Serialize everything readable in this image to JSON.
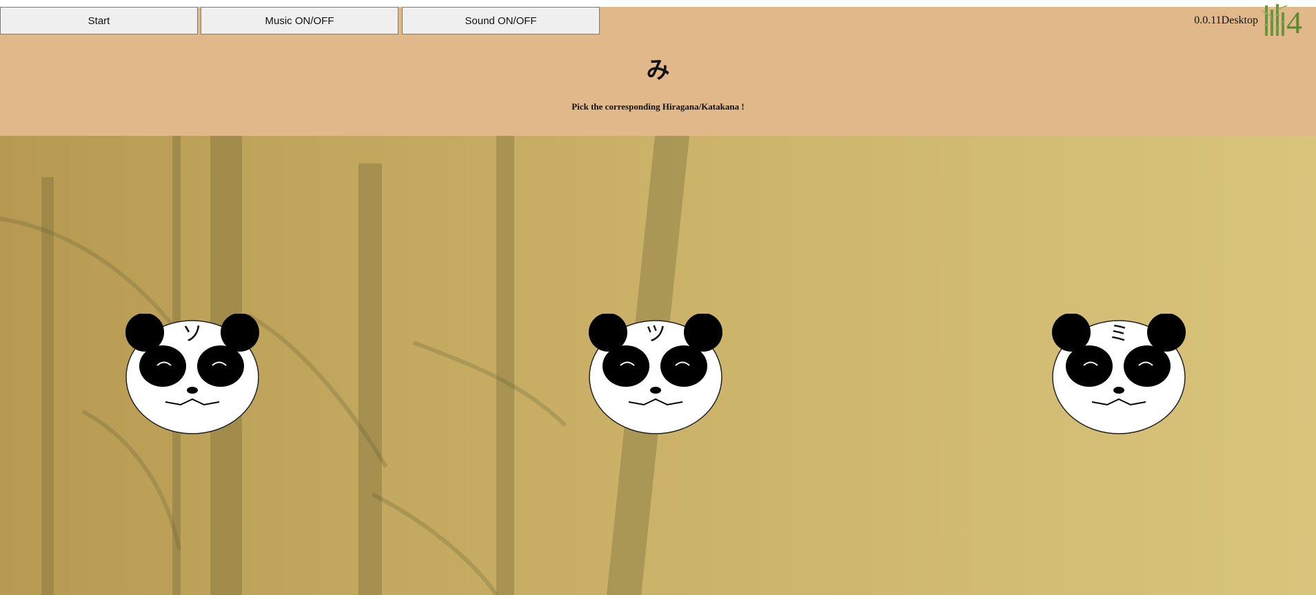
{
  "toolbar": {
    "start_label": "Start",
    "music_label": "Music ON/OFF",
    "sound_label": "Sound ON/OFF"
  },
  "version": {
    "text": "0.0.11Desktop",
    "logo_digit": "4",
    "logo_icon": "bamboo-icon"
  },
  "game": {
    "prompt_character": "み",
    "instruction": "Pick the corresponding Hiragana/Katakana !",
    "choices": [
      {
        "kana": "ソ",
        "icon": "panda-face-icon"
      },
      {
        "kana": "ツ",
        "icon": "panda-face-icon"
      },
      {
        "kana": "ミ",
        "icon": "panda-face-icon"
      }
    ]
  },
  "colors": {
    "header_bg": "#e1b889",
    "button_bg": "#efefef",
    "field_bg": "#cdb35d",
    "logo_green": "#5c8a2e"
  }
}
